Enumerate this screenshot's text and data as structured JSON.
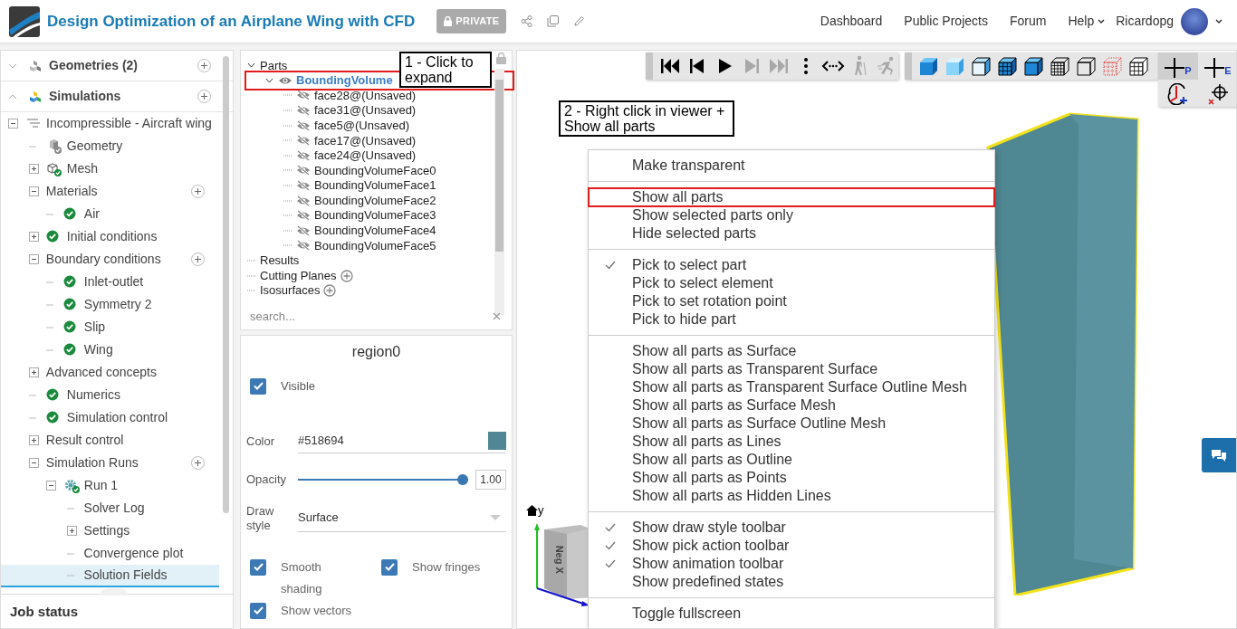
{
  "header": {
    "title": "Design Optimization of an Airplane Wing with CFD",
    "badge": "PRIVATE",
    "nav": [
      {
        "label": "Dashboard",
        "dropdown": false
      },
      {
        "label": "Public Projects",
        "dropdown": false
      },
      {
        "label": "Forum",
        "dropdown": false
      },
      {
        "label": "Help",
        "dropdown": true
      }
    ],
    "user": "Ricardopg"
  },
  "sidebar": {
    "sections": [
      {
        "label": "Geometries (2)",
        "kind": "geometries",
        "expanded": false
      },
      {
        "label": "Simulations",
        "kind": "simulations",
        "expanded": true
      }
    ],
    "tree": [
      {
        "label": "Incompressible - Aircraft wing",
        "kind": "flow",
        "expanded": true,
        "selected": false,
        "children": [
          {
            "label": "Geometry",
            "kind": "geometry",
            "selected": false
          },
          {
            "label": "Mesh",
            "kind": "mesh",
            "expanded": false,
            "selected": false
          },
          {
            "label": "Materials",
            "expanded": true,
            "addable": true,
            "selected": false,
            "children": [
              {
                "label": "Air",
                "kind": "check",
                "selected": false
              }
            ]
          },
          {
            "label": "Initial conditions",
            "kind": "check",
            "expanded": false,
            "selected": false
          },
          {
            "label": "Boundary conditions",
            "expanded": true,
            "addable": true,
            "selected": false,
            "children": [
              {
                "label": "Inlet-outlet",
                "kind": "check",
                "selected": false
              },
              {
                "label": "Symmetry 2",
                "kind": "check",
                "selected": false
              },
              {
                "label": "Slip",
                "kind": "check",
                "selected": false
              },
              {
                "label": "Wing",
                "kind": "check",
                "selected": false
              }
            ]
          },
          {
            "label": "Advanced concepts",
            "expanded": false,
            "selected": false
          },
          {
            "label": "Numerics",
            "kind": "check",
            "selected": false
          },
          {
            "label": "Simulation control",
            "kind": "check",
            "selected": false
          },
          {
            "label": "Result control",
            "expanded": false,
            "selected": false
          },
          {
            "label": "Simulation Runs",
            "expanded": true,
            "addable": true,
            "selected": false,
            "children": [
              {
                "label": "Run 1",
                "kind": "gear",
                "expanded": true,
                "selected": false,
                "children": [
                  {
                    "label": "Solver Log",
                    "selected": false
                  },
                  {
                    "label": "Settings",
                    "expanded": false,
                    "selected": false
                  },
                  {
                    "label": "Convergence plot",
                    "selected": false
                  },
                  {
                    "label": "Solution Fields",
                    "selected": true
                  }
                ]
              }
            ]
          }
        ]
      }
    ],
    "footer": "Job status"
  },
  "parts_panel": {
    "tree": [
      {
        "label": "Parts",
        "expanded": true,
        "children": [
          {
            "label": "BoundingVolume",
            "expanded": true,
            "visible": true,
            "highlighted": true,
            "children": [
              {
                "label": "face28@(Unsaved)",
                "visible": false
              },
              {
                "label": "face31@(Unsaved)",
                "visible": false
              },
              {
                "label": "face5@(Unsaved)",
                "visible": false
              },
              {
                "label": "face17@(Unsaved)",
                "visible": false
              },
              {
                "label": "face24@(Unsaved)",
                "visible": false
              },
              {
                "label": "BoundingVolumeFace0",
                "visible": false
              },
              {
                "label": "BoundingVolumeFace1",
                "visible": false
              },
              {
                "label": "BoundingVolumeFace2",
                "visible": false
              },
              {
                "label": "BoundingVolumeFace3",
                "visible": false
              },
              {
                "label": "BoundingVolumeFace4",
                "visible": false
              },
              {
                "label": "BoundingVolumeFace5",
                "visible": false
              }
            ]
          }
        ]
      },
      {
        "label": "Results"
      },
      {
        "label": "Cutting Planes",
        "addable": true
      },
      {
        "label": "Isosurfaces",
        "addable": true
      }
    ],
    "search_placeholder": "search..."
  },
  "properties": {
    "title": "region0",
    "visible": {
      "label": "Visible",
      "checked": true
    },
    "color": {
      "label": "Color",
      "value": "#518694"
    },
    "opacity": {
      "label": "Opacity",
      "level": 1.0,
      "value": "1.00"
    },
    "draw_style": {
      "label": "Draw style",
      "value": "Surface"
    },
    "options": [
      {
        "label": "Smooth shading",
        "checked": true
      },
      {
        "label": "Show fringes",
        "checked": true
      },
      {
        "label": "Show vectors",
        "checked": true
      }
    ]
  },
  "viewer": {
    "animation_toolbar": [
      {
        "kind": "first",
        "disabled": false
      },
      {
        "kind": "prev",
        "disabled": false
      },
      {
        "kind": "play",
        "disabled": false
      },
      {
        "kind": "next",
        "disabled": true
      },
      {
        "kind": "last",
        "disabled": true
      },
      {
        "kind": "more",
        "disabled": false
      },
      {
        "kind": "link",
        "disabled": false
      },
      {
        "kind": "walk",
        "disabled": true
      },
      {
        "kind": "run",
        "disabled": true
      }
    ],
    "draw_style_toolbar": [
      {
        "kind": "solid"
      },
      {
        "kind": "gradient"
      },
      {
        "kind": "outline"
      },
      {
        "kind": "mesh"
      },
      {
        "kind": "surface-outline"
      },
      {
        "kind": "dense-wire"
      },
      {
        "kind": "wire"
      },
      {
        "kind": "points"
      },
      {
        "kind": "hidden"
      }
    ],
    "pick_toolbar": [
      {
        "kind": "crosshair",
        "label": "P",
        "selected": true
      },
      {
        "kind": "crosshair",
        "label": "E",
        "selected": false
      },
      {
        "kind": "rotate",
        "selected": false
      },
      {
        "kind": "target",
        "selected": false
      }
    ],
    "annotations": [
      "1 - Click to expand",
      "2 - Right click in viewer + Show all parts"
    ],
    "context_menu": [
      [
        {
          "label": "Make transparent",
          "checked": false,
          "highlighted": false
        }
      ],
      [
        {
          "label": "Show all parts",
          "checked": false,
          "highlighted": true
        },
        {
          "label": "Show selected parts only",
          "checked": false,
          "highlighted": false
        },
        {
          "label": "Hide selected parts",
          "checked": false,
          "highlighted": false
        }
      ],
      [
        {
          "label": "Pick to select part",
          "checked": true,
          "highlighted": false
        },
        {
          "label": "Pick to select element",
          "checked": false,
          "highlighted": false
        },
        {
          "label": "Pick to set rotation point",
          "checked": false,
          "highlighted": false
        },
        {
          "label": "Pick to hide part",
          "checked": false,
          "highlighted": false
        }
      ],
      [
        {
          "label": "Show all parts as Surface",
          "checked": false,
          "highlighted": false
        },
        {
          "label": "Show all parts as Transparent Surface",
          "checked": false,
          "highlighted": false
        },
        {
          "label": "Show all parts as Transparent Surface Outline Mesh",
          "checked": false,
          "highlighted": false
        },
        {
          "label": "Show all parts as Surface Mesh",
          "checked": false,
          "highlighted": false
        },
        {
          "label": "Show all parts as Surface Outline Mesh",
          "checked": false,
          "highlighted": false
        },
        {
          "label": "Show all parts as Lines",
          "checked": false,
          "highlighted": false
        },
        {
          "label": "Show all parts as Outline",
          "checked": false,
          "highlighted": false
        },
        {
          "label": "Show all parts as Points",
          "checked": false,
          "highlighted": false
        },
        {
          "label": "Show all parts as Hidden Lines",
          "checked": false,
          "highlighted": false
        }
      ],
      [
        {
          "label": "Show draw style toolbar",
          "checked": true,
          "highlighted": false
        },
        {
          "label": "Show pick action toolbar",
          "checked": true,
          "highlighted": false
        },
        {
          "label": "Show animation toolbar",
          "checked": true,
          "highlighted": false
        },
        {
          "label": "Show predefined states",
          "checked": false,
          "highlighted": false
        }
      ],
      [
        {
          "label": "Toggle fullscreen",
          "checked": false,
          "highlighted": false
        }
      ]
    ],
    "axis": {
      "up_label": "y",
      "face_label": "Neg X"
    }
  }
}
